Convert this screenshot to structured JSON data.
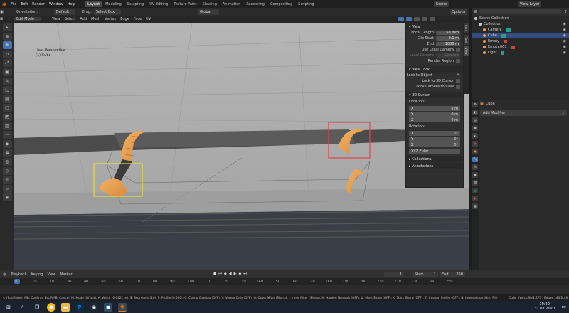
{
  "topbar": {
    "menus": [
      "File",
      "Edit",
      "Render",
      "Window",
      "Help"
    ],
    "workspaces": [
      "Layout",
      "Modeling",
      "Sculpting",
      "UV Editing",
      "Texture Paint",
      "Shading",
      "Animation",
      "Rendering",
      "Compositing",
      "Scripting"
    ],
    "active_workspace": "Layout",
    "scene_label": "Scene",
    "view_layer_label": "View Layer"
  },
  "tool_header": {
    "orientation_label": "Orientation:",
    "orientation_value": "Default",
    "drag_label": "Drag:",
    "drag_value": "Select Box",
    "transform_value": "Global",
    "options_label": "Options"
  },
  "viewport_header": {
    "mode": "Edit Mode",
    "menus": [
      "View",
      "Select",
      "Add",
      "Mesh",
      "Vertex",
      "Edge",
      "Face",
      "UV"
    ]
  },
  "viewport": {
    "perspective_text": "User Perspective",
    "object_text": "(1) Cube"
  },
  "npanel": {
    "view_header": "View",
    "focal_length_label": "Focal Length",
    "focal_length_value": "50 mm",
    "clip_start_label": "Clip Start",
    "clip_start_value": "0.1 m",
    "end_label": "End",
    "end_value": "1000 m",
    "use_local_camera": "Use Local Camera",
    "local_camera_label": "Local Camera",
    "local_camera_value": "Camera",
    "render_region": "Render Region",
    "view_lock_header": "View Lock",
    "lock_to_object": "Lock to Object",
    "lock_to_cursor": "Lock to 3D Cursor",
    "lock_camera": "Lock Camera to View",
    "cursor_header": "3D Cursor",
    "location_label": "Location:",
    "rotation_label": "Rotation:",
    "loc": [
      {
        "axis": "X",
        "val": "0 m"
      },
      {
        "axis": "Y",
        "val": "0 m"
      },
      {
        "axis": "Z",
        "val": "0 m"
      }
    ],
    "rot": [
      {
        "axis": "X",
        "val": "0°"
      },
      {
        "axis": "Y",
        "val": "0°"
      },
      {
        "axis": "Z",
        "val": "0°"
      }
    ],
    "rot_mode": "XYZ Euler",
    "collections_header": "Collections",
    "annotations_header": "Annotations"
  },
  "vtabs": [
    "Item",
    "Tool",
    "View"
  ],
  "outliner": {
    "rows": [
      {
        "label": "Scene Collection",
        "color": "#d0d0d0",
        "sel": false
      },
      {
        "label": "Collection",
        "color": "#d0d0d0",
        "sel": false
      },
      {
        "label": "Camera",
        "color": "#e8a33e",
        "sel": false
      },
      {
        "label": "Cube",
        "color": "#e8a33e",
        "sel": true
      },
      {
        "label": "Empty",
        "color": "#e8a33e",
        "sel": false
      },
      {
        "label": "Empty.003",
        "color": "#e8a33e",
        "sel": false
      },
      {
        "label": "Light",
        "color": "#e8a33e",
        "sel": false
      }
    ]
  },
  "properties": {
    "object_name": "Cube",
    "add_modifier": "Add Modifier"
  },
  "timeline": {
    "menus": [
      "Playback",
      "Keying",
      "View",
      "Marker"
    ],
    "current_frame": "1",
    "start_label": "Start",
    "start_value": "1",
    "end_label": "End",
    "end_value": "250",
    "ticks": [
      "0",
      "10",
      "20",
      "30",
      "40",
      "50",
      "60",
      "70",
      "80",
      "90",
      "100",
      "110",
      "120",
      "130",
      "140",
      "150",
      "160",
      "170",
      "180",
      "190",
      "200",
      "210",
      "220",
      "230",
      "240",
      "250"
    ]
  },
  "status": {
    "left_text": "<-(RadEnter), MB: Confirm, Esc/RMB: Cancel, M: Mode (Offset), A: Width (0.0422 m), S: Segments (10), P: Profile (0.500), C: Clamp Overlap (OFF), V: Vertex Only (OFF), O: Outer Miter (Sharp), I: Inner Miter (Sharp), H: Harden Normals (OFF), U: Mark Seam (OFF), K: Mark Sharp (OFF), Z: Custom Profile (OFF), N: Intersection (Grid Fill)",
    "right_text": "Cube | Verts:90/1,273 | Edges:140/2,48"
  },
  "taskbar": {
    "time": "19:20",
    "date": "31.07.2020"
  }
}
